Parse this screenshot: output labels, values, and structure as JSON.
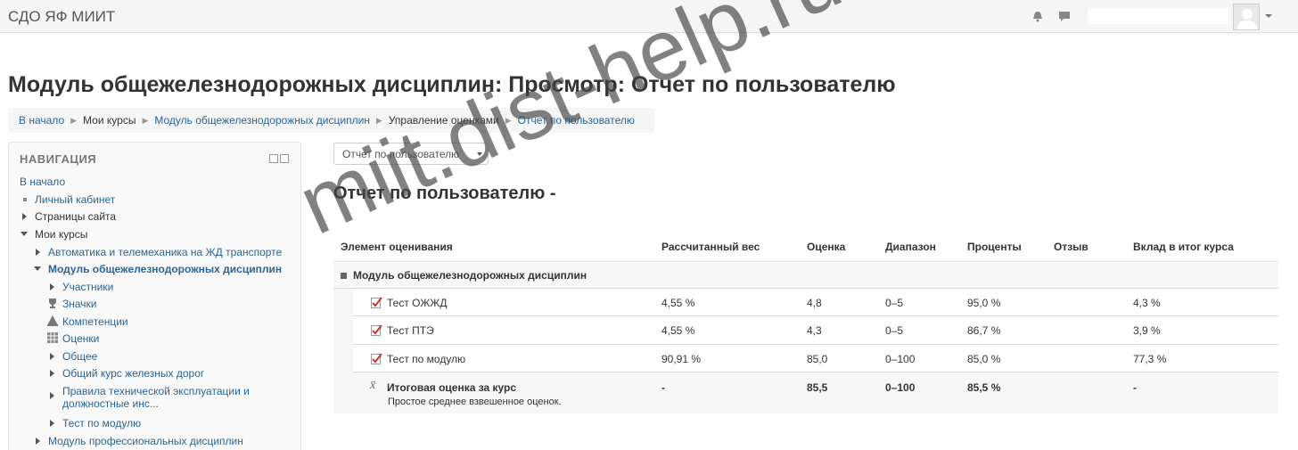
{
  "app": {
    "brand": "СДО ЯФ МИИТ"
  },
  "header": {
    "page_title": "Модуль общежелезнодорожных дисциплин: Просмотр: Отчет по пользователю",
    "breadcrumb": [
      "В начало",
      "Мои курсы",
      "Модуль общежелезнодорожных дисциплин",
      "Управление оценками",
      "Отчет по пользователю"
    ]
  },
  "navigation": {
    "title": "НАВИГАЦИЯ",
    "items": [
      {
        "label": "В начало"
      },
      {
        "label": "Личный кабинет"
      },
      {
        "label": "Страницы сайта"
      },
      {
        "label": "Мои курсы"
      },
      {
        "label": "Автоматика и телемеханика на ЖД транспорте"
      },
      {
        "label": "Модуль общежелезнодорожных дисциплин"
      },
      {
        "label": "Участники"
      },
      {
        "label": "Значки"
      },
      {
        "label": "Компетенции"
      },
      {
        "label": "Оценки"
      },
      {
        "label": "Общее"
      },
      {
        "label": "Общий курс железных дорог"
      },
      {
        "label": "Правила технической эксплуатации и"
      },
      {
        "label": "должностные инс..."
      },
      {
        "label": "Тест по модулю"
      },
      {
        "label": "Модуль профессиональных дисциплин"
      }
    ]
  },
  "report": {
    "selector_value": "Отчет по пользователю",
    "title": "Отчет по пользователю -",
    "columns": [
      "Элемент оценивания",
      "Рассчитанный вес",
      "Оценка",
      "Диапазон",
      "Проценты",
      "Отзыв",
      "Вклад в итог курса"
    ],
    "category": "Модуль общежелезнодорожных дисциплин",
    "rows": [
      {
        "item": "Тест ОЖЖД",
        "weight": "4,55 %",
        "grade": "4,8",
        "range": "0–5",
        "percent": "95,0 %",
        "feedback": "",
        "contribution": "4,3 %"
      },
      {
        "item": "Тест ПТЭ",
        "weight": "4,55 %",
        "grade": "4,3",
        "range": "0–5",
        "percent": "86,7 %",
        "feedback": "",
        "contribution": "3,9 %"
      },
      {
        "item": "Тест по модулю",
        "weight": "90,91 %",
        "grade": "85,0",
        "range": "0–100",
        "percent": "85,0 %",
        "feedback": "",
        "contribution": "77,3 %"
      }
    ],
    "total": {
      "item": "Итоговая оценка за курс",
      "note": "Простое среднее взвешенное оценок.",
      "weight": "-",
      "grade": "85,5",
      "range": "0–100",
      "percent": "85,5 %",
      "contribution": "-"
    }
  },
  "watermark": "miit.dist-help.ru"
}
